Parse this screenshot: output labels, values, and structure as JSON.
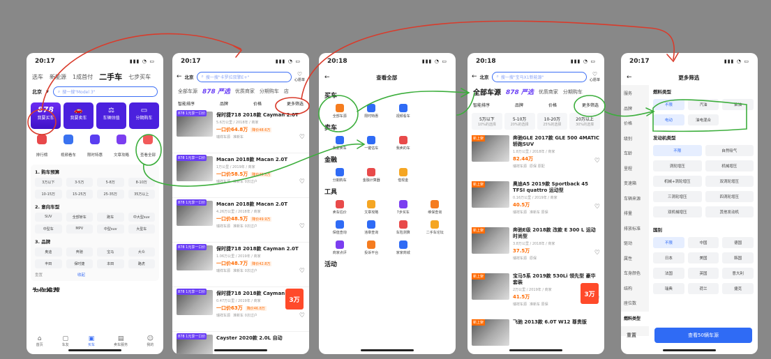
{
  "p1": {
    "time": "20:17",
    "tabs": [
      "选车",
      "新能源",
      "1成首付",
      "二手车",
      "七步买车"
    ],
    "city": "北京",
    "search": "搜一搜\"Model 3\"",
    "cards": [
      "我要买车",
      "我要卖车",
      "车辆估值",
      "分期购车"
    ],
    "card_logo": "878",
    "icons": [
      "排行榜",
      "视频看车",
      "限时特惠",
      "文章攻略",
      "查看全部"
    ],
    "sec1": "1. 购车预算",
    "budgets": [
      "3万以下",
      "3-5万",
      "5-8万",
      "8-10万",
      "10-15万",
      "15-25万",
      "25-35万",
      "35万以上"
    ],
    "sec2": "2. 意向车型",
    "types": [
      "SUV",
      "全部轿车",
      "跑车",
      "中大型suv",
      "中型车",
      "MPV",
      "中型suv",
      "大型车"
    ],
    "sec3": "3. 品牌",
    "brands": [
      "奥迪",
      "奔驰",
      "宝马",
      "大众",
      "丰田",
      "保时捷",
      "本田",
      "路虎"
    ],
    "reset": "重置",
    "collapse": "收起",
    "title_partial": "为你推荐",
    "nav": [
      "首页",
      "车友",
      "买车",
      "卖车服务",
      "我的"
    ]
  },
  "p2": {
    "time": "20:17",
    "city": "北京",
    "search": "搜一搜\"卡罗拉双擎E+\"",
    "fav": "心愿单",
    "tabs": [
      "全部车源",
      "878 严选",
      "优质商家",
      "分期购车",
      "店"
    ],
    "filters": [
      "智能排序",
      "品牌",
      "价格",
      "更多筛选"
    ],
    "cars": [
      {
        "tag": "878 1元享一口价",
        "name": "保时捷718 2018款 Cayman 2.0T",
        "meta": "5.6万公里 / 2018年 / 商家",
        "price": "一口价64.8万",
        "down": "降价48.6万",
        "seller": "瑞祥车源",
        "extra": "准新车"
      },
      {
        "tag": "878 1元享一口价",
        "name": "Macan 2018款 Macan 2.0T",
        "meta": "1万公里 / 2019年 / 商家",
        "price": "一口价58.5万",
        "down": "降价49.5万",
        "seller": "瑞祥车源",
        "extra": "准新车 0次过户"
      },
      {
        "tag": "878 1元享一口价",
        "name": "Macan 2018款 Macan 2.0T",
        "meta": "4.26万公里 / 2018年 / 商家",
        "price": "一口价48.5万",
        "down": "降价49.9万",
        "seller": "瑞祥车源",
        "extra": "准新车 0次过户"
      },
      {
        "tag": "878 1元享一口价",
        "name": "保时捷718 2018款 Cayman 2.0T",
        "meta": "1.06万公里 / 2019年 / 商家",
        "price": "一口价48.7万",
        "down": "降价42.8万",
        "seller": "瑞祥车源",
        "extra": "准新车 0次过户"
      },
      {
        "tag": "878 1元享一口价",
        "name": "保时捷718 2018款 Cayman 2.0T",
        "meta": "0.47万公里 / 2019年 / 商家",
        "price": "一口价63万",
        "down": "降价46.8万",
        "seller": "瑞祥车源",
        "extra": "准新车 0次过户"
      },
      {
        "tag": "878 1元享一口价",
        "name": "Cayster 2020款 2.0L 自动",
        "meta": "",
        "price": "",
        "down": "",
        "seller": "",
        "extra": ""
      }
    ],
    "promo": "3万"
  },
  "p3": {
    "time": "20:18",
    "title": "查看全部",
    "sections": [
      {
        "h": "买车",
        "items": [
          "全部车源",
          "限时特惠",
          "视频看车"
        ]
      },
      {
        "h": "卖车",
        "items": [
          "我要卖车",
          "一键估车",
          "我卖的车"
        ]
      },
      {
        "h": "金融",
        "items": [
          "分期购车",
          "金融计算器",
          "借现金"
        ]
      },
      {
        "h": "工具",
        "items": [
          "卖车估价",
          "文章攻略",
          "7步买车",
          "维保查询",
          "保值查询",
          "违章查询",
          "车险测算",
          "二手车论坛",
          "商家点评",
          "投诉平台",
          "家家商城"
        ]
      },
      {
        "h": "活动",
        "items": []
      }
    ]
  },
  "p4": {
    "time": "20:18",
    "city": "北京",
    "search": "搜一搜\"宝马X1新能源\"",
    "fav": "心愿单",
    "tabs": [
      "全部车源",
      "878 严选",
      "优质商家",
      "分期购车"
    ],
    "filters": [
      "智能排序",
      "品牌",
      "价格",
      "更多筛选"
    ],
    "ranges": [
      {
        "r": "5万以下",
        "s": "10%的选择"
      },
      {
        "r": "5-10万",
        "s": "20%的选择"
      },
      {
        "r": "10-20万",
        "s": "25%的选择"
      },
      {
        "r": "20万以上",
        "s": "30%的选择"
      }
    ],
    "cars": [
      {
        "name": "奔驰GLE 2017款 GLE 500 4MATIC 轿跑SUV",
        "meta": "1.8万公里 / 2018年 / 商家",
        "price": "82.44万",
        "seller": "瑞祥车源",
        "tags": "原保 原配",
        "badge": "新上架"
      },
      {
        "name": "奥迪A5 2019款 Sportback 45 TFSI quattro 运动型",
        "meta": "0.16万公里 / 2019年 / 商家",
        "price": "40.5万",
        "seller": "瑞祥车源",
        "tags": "准新车 原保",
        "badge": "新上架"
      },
      {
        "name": "奔驰E级 2018款 改款 E 300 L 运动时尚型",
        "meta": "3.8万公里 / 2018年 / 商家",
        "price": "37.5万",
        "seller": "瑞祥车源",
        "tags": "原保",
        "badge": "新上架"
      },
      {
        "name": "宝马5系 2019款 530Li 领先型 豪华套装",
        "meta": "2万公里 / 2019年 / 商家",
        "price": "41.5万",
        "seller": "瑞祥车源",
        "tags": "准新车 原保",
        "badge": "新上架"
      },
      {
        "name": "飞驰 2013款 6.0T W12 尊贵版",
        "meta": "",
        "price": "",
        "seller": "",
        "tags": "",
        "badge": "新上架"
      }
    ],
    "promo": "3万"
  },
  "p5": {
    "time": "20:17",
    "title": "更多筛选",
    "side": [
      "服务",
      "品牌",
      "价格",
      "级别",
      "车龄",
      "里程",
      "变速箱",
      "车辆来源",
      "排量",
      "排放标准",
      "驱动",
      "属性",
      "车身颜色",
      "结构",
      "座位数",
      "燃料类型"
    ],
    "fuel_h": "燃料类型",
    "fuel": [
      "不限",
      "汽油",
      "柴油",
      "电动",
      "油电混合"
    ],
    "engine_h": "发动机类型",
    "engine": [
      "不限",
      "自然吸气",
      "涡轮增压",
      "机械增压",
      "机械+涡轮增压",
      "双涡轮增压",
      "三涡轮增压",
      "四涡轮增压",
      "双机械增压",
      "其他发动机"
    ],
    "country_h": "国别",
    "country": [
      "不限",
      "中国",
      "德国",
      "日本",
      "美国",
      "韩国",
      "法国",
      "英国",
      "意大利",
      "瑞典",
      "荷兰",
      "捷克"
    ],
    "reset": "重置",
    "submit": "查看50辆车源"
  }
}
